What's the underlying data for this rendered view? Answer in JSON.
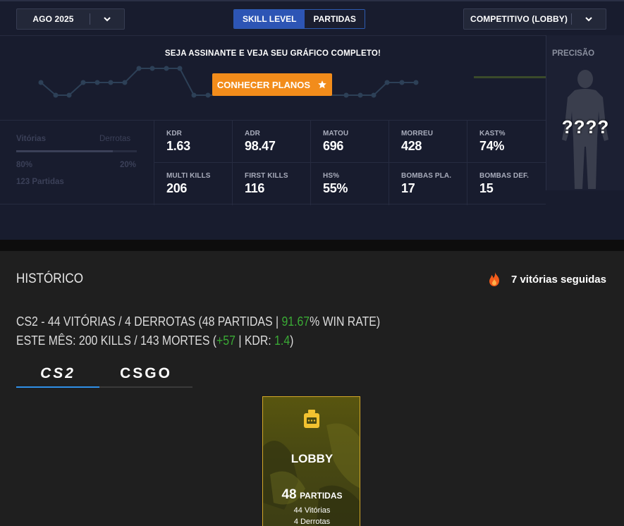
{
  "controls": {
    "date_label": "AGO 2025",
    "toggle": {
      "skill_level": "SKILL LEVEL",
      "partidas": "PARTIDAS",
      "active": "skill_level"
    },
    "mode_label": "COMPETITIVO (LOBBY)"
  },
  "promo": {
    "message": "SEJA ASSINANTE E VEJA SEU GRÁFICO COMPLETO!",
    "button_label": "CONHECER PLANOS"
  },
  "blurred": {
    "wins_label": "Vitórias",
    "losses_label": "Derrotas",
    "win_pct": "80%",
    "loss_pct": "20%",
    "matches": "123 Partidas"
  },
  "stats": [
    {
      "label": "KDR",
      "value": "1.63"
    },
    {
      "label": "ADR",
      "value": "98.47"
    },
    {
      "label": "MATOU",
      "value": "696"
    },
    {
      "label": "MORREU",
      "value": "428"
    },
    {
      "label": "KAST%",
      "value": "74%"
    },
    {
      "label": "MULTI KILLS",
      "value": "206"
    },
    {
      "label": "FIRST KILLS",
      "value": "116"
    },
    {
      "label": "HS%",
      "value": "55%"
    },
    {
      "label": "BOMBAS PLA.",
      "value": "17"
    },
    {
      "label": "BOMBAS DEF.",
      "value": "15"
    }
  ],
  "precision": {
    "title": "PRECISÃO",
    "hidden_value": "????"
  },
  "history": {
    "title": "HISTÓRICO",
    "streak": "7 vitórias seguidas",
    "line1_pre": "CS2 - 44 VITÓRIAS / 4 DERROTAS (48 PARTIDAS | ",
    "line1_rate": "91.67",
    "line1_post": "% WIN RATE)",
    "line2_pre": "ESTE MÊS: 200 KILLS / 143 MORTES (",
    "line2_diff": "+57",
    "line2_mid": " | KDR: ",
    "line2_kdr": "1.4",
    "line2_post": ")"
  },
  "game_tabs": {
    "cs2": "CS2",
    "csgo": "CSGO",
    "active": "cs2"
  },
  "lobby_card": {
    "title": "LOBBY",
    "matches_count": "48",
    "matches_label": "PARTIDAS",
    "wins": "44 Vitórias",
    "losses": "4 Derrotas"
  },
  "colors": {
    "accent_blue": "#2d55b5",
    "accent_orange": "#f28c1b",
    "positive_green": "#3aaa35",
    "tab_underline": "#2f8fe8",
    "card_border": "#d4a828"
  }
}
